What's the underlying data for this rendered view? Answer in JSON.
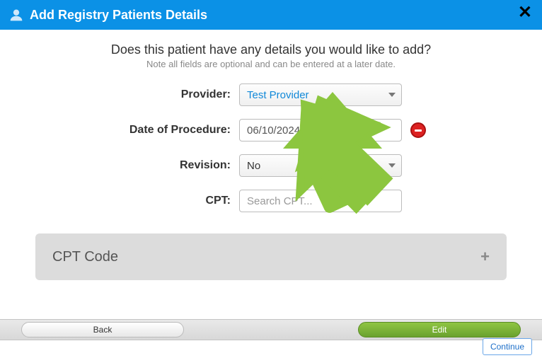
{
  "header": {
    "title": "Add Registry Patients Details"
  },
  "prompt": {
    "question": "Does this patient have any details you would like to add?",
    "note": "Note all fields are optional and can be entered at a later date."
  },
  "form": {
    "provider": {
      "label": "Provider:",
      "value": "Test Provider"
    },
    "date_of_procedure": {
      "label": "Date of Procedure:",
      "value": "06/10/2024"
    },
    "revision": {
      "label": "Revision:",
      "value": "No"
    },
    "cpt": {
      "label": "CPT:",
      "placeholder": "Search CPT..."
    }
  },
  "cpt_section": {
    "heading": "CPT Code",
    "add_symbol": "+"
  },
  "footer": {
    "back": "Back",
    "edit": "Edit",
    "continue": "Continue"
  }
}
